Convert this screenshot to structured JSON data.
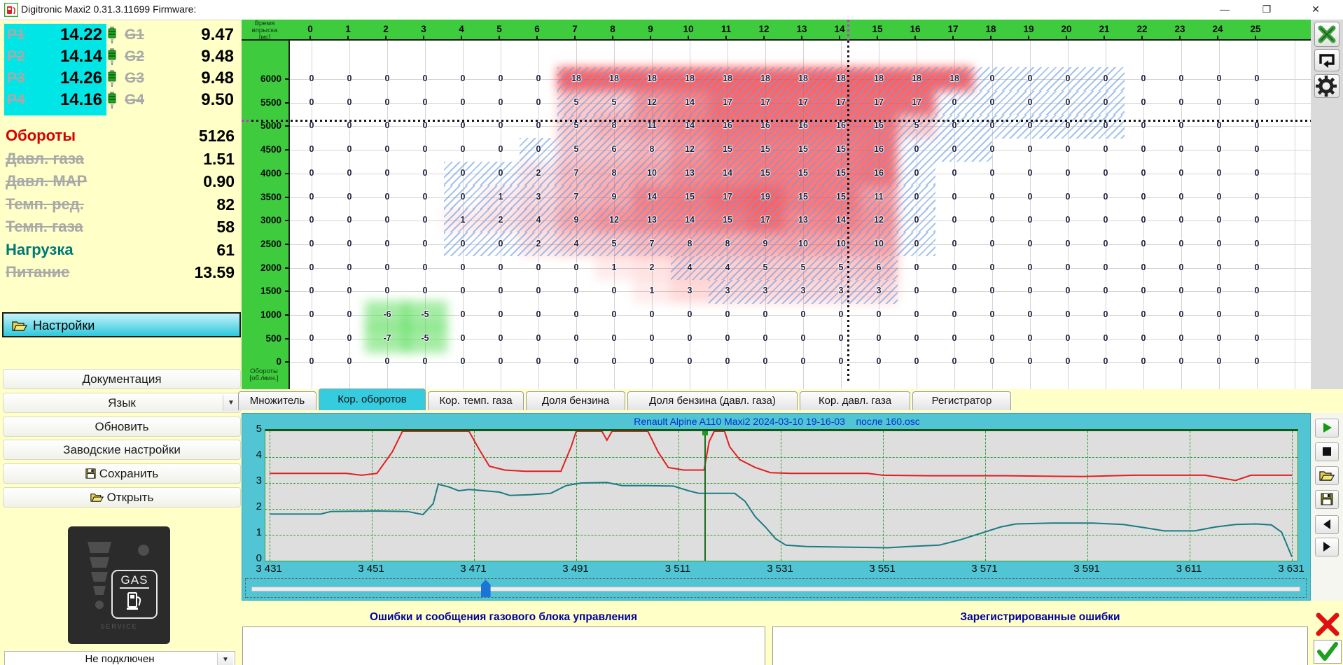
{
  "window": {
    "title": "Digitronic Maxi2 0.31.3.11699 Firmware:",
    "minimize": "—",
    "maximize": "❐",
    "close": "✕"
  },
  "telemetry": {
    "injector_rows": [
      {
        "p_label": "P1",
        "p_value": "14.22",
        "g_label": "G1",
        "g_value": "9.47"
      },
      {
        "p_label": "P2",
        "p_value": "14.14",
        "g_label": "G2",
        "g_value": "9.48"
      },
      {
        "p_label": "P3",
        "p_value": "14.26",
        "g_label": "G3",
        "g_value": "9.48"
      },
      {
        "p_label": "P4",
        "p_value": "14.16",
        "g_label": "G4",
        "g_value": "9.50"
      }
    ],
    "params": [
      {
        "label": "Обороты",
        "value": "5126",
        "style": "red"
      },
      {
        "label": "Давл. газа",
        "value": "1.51",
        "style": "off"
      },
      {
        "label": "Давл. MAP",
        "value": "0.90",
        "style": "off"
      },
      {
        "label": "Темп. ред.",
        "value": "82",
        "style": "off"
      },
      {
        "label": "Темп. газа",
        "value": "58",
        "style": "off"
      },
      {
        "label": "Нагрузка",
        "value": "61",
        "style": "teal"
      },
      {
        "label": "Питание",
        "value": "13.59",
        "style": "off"
      }
    ],
    "colors": {
      "active_red": "#D50000",
      "active_teal": "#007878",
      "inactive": "#A9A9A9"
    }
  },
  "sidebar": {
    "settings_label": "Настройки",
    "buttons": [
      {
        "label": "Документация",
        "icon": ""
      },
      {
        "label": "Язык",
        "icon": "",
        "combo": true
      },
      {
        "label": "Обновить",
        "icon": ""
      },
      {
        "label": "Заводские настройки",
        "icon": ""
      },
      {
        "label": "Сохранить",
        "icon": "save"
      },
      {
        "label": "Открыть",
        "icon": "open"
      }
    ],
    "gas_indicator": {
      "label": "GAS",
      "service": "SERVICE"
    },
    "connection_status": "Не подключен"
  },
  "map": {
    "x_axis_title": "Время\nвпрыска\n[мс]",
    "y_axis_title": "Обороты\n[об./мин.]",
    "x_ticks": [
      0,
      1,
      2,
      3,
      4,
      5,
      6,
      7,
      8,
      9,
      10,
      11,
      12,
      13,
      14,
      15,
      16,
      17,
      18,
      19,
      20,
      21,
      22,
      23,
      24,
      25
    ],
    "y_ticks": [
      6000,
      5500,
      5000,
      4500,
      4000,
      3500,
      3000,
      2500,
      2000,
      1500,
      1000,
      500,
      0
    ],
    "values": [
      [
        0,
        0,
        0,
        0,
        0,
        0,
        0,
        18,
        18,
        18,
        18,
        18,
        18,
        18,
        18,
        18,
        18,
        18,
        0,
        0,
        0,
        0,
        0,
        0,
        0,
        0
      ],
      [
        0,
        0,
        0,
        0,
        0,
        0,
        0,
        5,
        5,
        12,
        14,
        17,
        17,
        17,
        17,
        17,
        17,
        0,
        0,
        0,
        0,
        0,
        0,
        0,
        0,
        0
      ],
      [
        0,
        0,
        0,
        0,
        0,
        0,
        0,
        5,
        8,
        11,
        14,
        16,
        16,
        16,
        16,
        16,
        5,
        0,
        0,
        0,
        0,
        0,
        0,
        0,
        0,
        0
      ],
      [
        0,
        0,
        0,
        0,
        0,
        0,
        0,
        5,
        6,
        8,
        12,
        15,
        15,
        15,
        15,
        16,
        0,
        0,
        0,
        0,
        0,
        0,
        0,
        0,
        0,
        0
      ],
      [
        0,
        0,
        0,
        0,
        0,
        0,
        2,
        7,
        8,
        10,
        13,
        14,
        15,
        15,
        15,
        16,
        0,
        0,
        0,
        0,
        0,
        0,
        0,
        0,
        0,
        0
      ],
      [
        0,
        0,
        0,
        0,
        0,
        1,
        3,
        7,
        9,
        14,
        15,
        17,
        19,
        15,
        15,
        11,
        0,
        0,
        0,
        0,
        0,
        0,
        0,
        0,
        0,
        0
      ],
      [
        0,
        0,
        0,
        0,
        1,
        2,
        4,
        9,
        12,
        13,
        14,
        15,
        17,
        13,
        14,
        12,
        0,
        0,
        0,
        0,
        0,
        0,
        0,
        0,
        0,
        0
      ],
      [
        0,
        0,
        0,
        0,
        0,
        0,
        2,
        4,
        5,
        7,
        8,
        8,
        9,
        10,
        10,
        10,
        0,
        0,
        0,
        0,
        0,
        0,
        0,
        0,
        0,
        0
      ],
      [
        0,
        0,
        0,
        0,
        0,
        0,
        0,
        0,
        1,
        2,
        4,
        4,
        5,
        5,
        5,
        6,
        0,
        0,
        0,
        0,
        0,
        0,
        0,
        0,
        0,
        0
      ],
      [
        0,
        0,
        0,
        0,
        0,
        0,
        0,
        0,
        0,
        1,
        3,
        3,
        3,
        3,
        3,
        3,
        0,
        0,
        0,
        0,
        0,
        0,
        0,
        0,
        0,
        0
      ],
      [
        0,
        0,
        -6,
        -5,
        0,
        0,
        0,
        0,
        0,
        0,
        0,
        0,
        0,
        0,
        0,
        0,
        0,
        0,
        0,
        0,
        0,
        0,
        0,
        0,
        0,
        0
      ],
      [
        0,
        0,
        -7,
        -5,
        0,
        0,
        0,
        0,
        0,
        0,
        0,
        0,
        0,
        0,
        0,
        0,
        0,
        0,
        0,
        0,
        0,
        0,
        0,
        0,
        0,
        0
      ],
      [
        0,
        0,
        0,
        0,
        0,
        0,
        0,
        0,
        0,
        0,
        0,
        0,
        0,
        0,
        0,
        0,
        0,
        0,
        0,
        0,
        0,
        0,
        0,
        0,
        0,
        0
      ]
    ],
    "hatch_spans": [
      [
        6.5,
        21.5
      ],
      [
        6.5,
        21.5
      ],
      [
        6.5,
        21.5
      ],
      [
        5.5,
        18.0
      ],
      [
        3.5,
        16.5
      ],
      [
        3.5,
        16.5
      ],
      [
        3.5,
        16.5
      ],
      [
        3.5,
        16.5
      ],
      [
        9.5,
        15.5
      ],
      [
        10.5,
        15.5
      ],
      null,
      null,
      null
    ],
    "crosshair": {
      "rpm": 5126,
      "time_ms": 14.2
    }
  },
  "tabs": [
    {
      "label": "Множитель",
      "active": false
    },
    {
      "label": "Кор. оборотов",
      "active": true
    },
    {
      "label": "Кор. темп. газа",
      "active": false
    },
    {
      "label": "Доля бензина",
      "active": false
    },
    {
      "label": "Доля бензина (давл. газа)",
      "active": false
    },
    {
      "label": "Кор. давл. газа",
      "active": false
    },
    {
      "label": "Регистратор",
      "active": false
    }
  ],
  "chart_data": {
    "type": "line",
    "title": "Renault Alpine A110 Maxi2 2024-03-10 19-16-03    после 160.osc",
    "xlim": [
      3431,
      3631
    ],
    "ylim": [
      0,
      5
    ],
    "x_tick_step": 20,
    "x_tick_labels": [
      "3 431",
      "3 451",
      "3 471",
      "3 491",
      "3 511",
      "3 531",
      "3 551",
      "3 571",
      "3 591",
      "3 611",
      "3 631"
    ],
    "y_ticks": [
      5,
      4,
      3,
      2,
      1,
      0
    ],
    "grid": "dashed-green",
    "cursor_x": 3516,
    "slider_fraction": 0.22,
    "series": [
      {
        "name": "petrol-correction",
        "color": "#E02020",
        "points": [
          [
            3431,
            3.37
          ],
          [
            3446,
            3.37
          ],
          [
            3449,
            3.3
          ],
          [
            3452,
            3.37
          ],
          [
            3455,
            4.2
          ],
          [
            3457,
            5
          ],
          [
            3470,
            5
          ],
          [
            3472,
            4.3
          ],
          [
            3474,
            3.65
          ],
          [
            3477,
            3.5
          ],
          [
            3481,
            3.45
          ],
          [
            3488,
            3.45
          ],
          [
            3490,
            4.4
          ],
          [
            3491,
            5
          ],
          [
            3496,
            5
          ],
          [
            3497,
            4.65
          ],
          [
            3498,
            5
          ],
          [
            3505,
            5
          ],
          [
            3507,
            4.2
          ],
          [
            3509,
            3.6
          ],
          [
            3512,
            3.5
          ],
          [
            3516,
            3.5
          ],
          [
            3517,
            4.6
          ],
          [
            3518,
            5
          ],
          [
            3520,
            5
          ],
          [
            3521,
            4.4
          ],
          [
            3523,
            3.9
          ],
          [
            3526,
            3.6
          ],
          [
            3529,
            3.4
          ],
          [
            3533,
            3.37
          ],
          [
            3548,
            3.37
          ],
          [
            3551,
            3.3
          ],
          [
            3560,
            3.28
          ],
          [
            3575,
            3.28
          ],
          [
            3590,
            3.25
          ],
          [
            3600,
            3.3
          ],
          [
            3614,
            3.3
          ],
          [
            3617,
            3.2
          ],
          [
            3620,
            3.1
          ],
          [
            3623,
            3.3
          ],
          [
            3631,
            3.3
          ]
        ]
      },
      {
        "name": "gas-correction",
        "color": "#1B7B82",
        "points": [
          [
            3431,
            1.8
          ],
          [
            3441,
            1.8
          ],
          [
            3443,
            1.9
          ],
          [
            3452,
            1.92
          ],
          [
            3458,
            1.9
          ],
          [
            3461,
            1.78
          ],
          [
            3463,
            2.2
          ],
          [
            3464,
            2.95
          ],
          [
            3466,
            2.85
          ],
          [
            3468,
            2.7
          ],
          [
            3470,
            2.75
          ],
          [
            3473,
            2.7
          ],
          [
            3476,
            2.65
          ],
          [
            3478,
            2.52
          ],
          [
            3482,
            2.55
          ],
          [
            3486,
            2.6
          ],
          [
            3489,
            2.9
          ],
          [
            3492,
            3.0
          ],
          [
            3497,
            3.02
          ],
          [
            3500,
            2.9
          ],
          [
            3505,
            2.9
          ],
          [
            3510,
            2.88
          ],
          [
            3513,
            2.7
          ],
          [
            3515,
            2.6
          ],
          [
            3522,
            2.6
          ],
          [
            3524,
            2.3
          ],
          [
            3526,
            1.7
          ],
          [
            3528,
            1.3
          ],
          [
            3530,
            0.85
          ],
          [
            3532,
            0.6
          ],
          [
            3536,
            0.55
          ],
          [
            3545,
            0.52
          ],
          [
            3552,
            0.5
          ],
          [
            3556,
            0.55
          ],
          [
            3562,
            0.6
          ],
          [
            3566,
            0.8
          ],
          [
            3570,
            1.05
          ],
          [
            3574,
            1.3
          ],
          [
            3577,
            1.42
          ],
          [
            3584,
            1.45
          ],
          [
            3592,
            1.45
          ],
          [
            3598,
            1.4
          ],
          [
            3602,
            1.28
          ],
          [
            3606,
            1.15
          ],
          [
            3612,
            1.15
          ],
          [
            3616,
            1.3
          ],
          [
            3620,
            1.4
          ],
          [
            3624,
            1.42
          ],
          [
            3627,
            1.38
          ],
          [
            3629,
            1.1
          ],
          [
            3631,
            0.15
          ]
        ]
      }
    ]
  },
  "errors": {
    "gas_ecu_title": "Ошибки и сообщения газового блока управления",
    "registered_title": "Зарегистрированные ошибки"
  }
}
